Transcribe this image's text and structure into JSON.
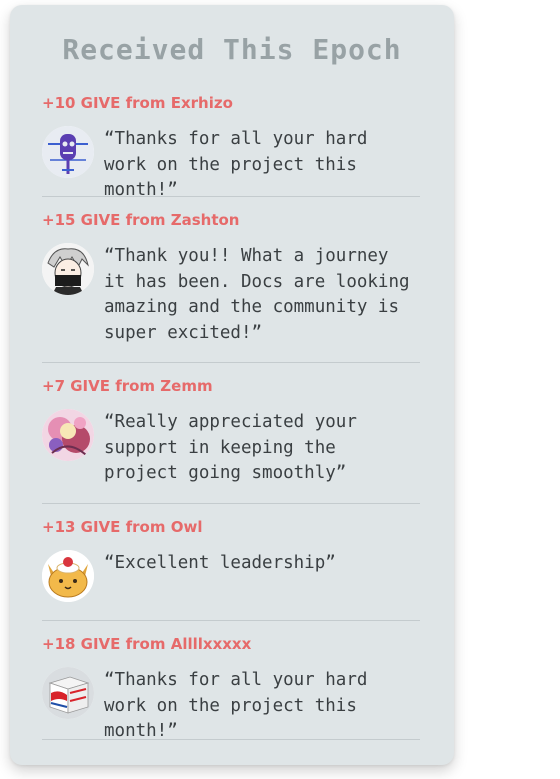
{
  "title": "Received This Epoch",
  "entries": [
    {
      "giver": "+10 GIVE from Exrhizo",
      "message": "“Thanks for all your hard work on the project this month!”",
      "avatar": "blue-robot-avatar"
    },
    {
      "giver": "+15 GIVE from Zashton",
      "message": "“Thank you!! What a journey it has been. Docs are looking amazing and the community is super excited!”",
      "avatar": "anime-character-avatar"
    },
    {
      "giver": "+7 GIVE from Zemm",
      "message": "“Really appreciated your support in keeping the project going smoothly”",
      "avatar": "colorful-art-avatar"
    },
    {
      "giver": "+13 GIVE from Owl",
      "message": "“Excellent leadership”",
      "avatar": "cat-cake-avatar"
    },
    {
      "giver": "+18 GIVE from Allllxxxxx",
      "message": "“Thanks for all your hard work on the project this month!”",
      "avatar": "brillo-box-avatar"
    }
  ]
}
